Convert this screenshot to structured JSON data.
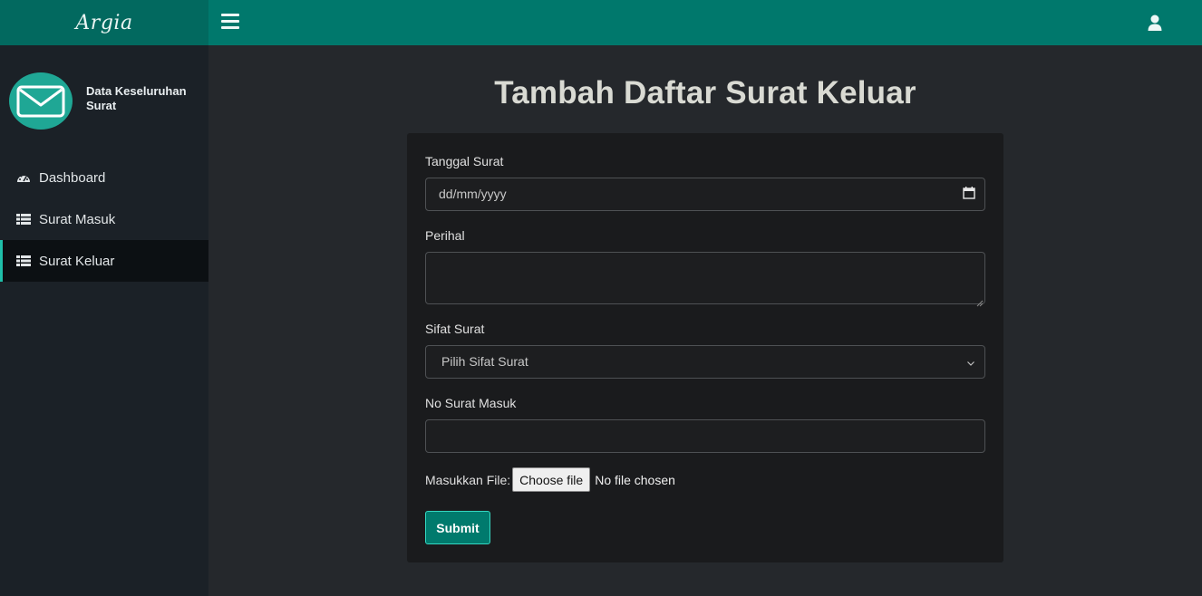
{
  "brand": {
    "name": "Argia"
  },
  "topbar": {
    "menu_icon": "hamburger-icon",
    "user_icon": "user-icon",
    "color": "#00786c"
  },
  "sidebar": {
    "profile": {
      "avatar_icon": "envelope-icon",
      "name": "Data Keseluruhan Surat"
    },
    "items": [
      {
        "label": "Dashboard",
        "icon": "dashboard-icon",
        "active": false
      },
      {
        "label": "Surat Masuk",
        "icon": "table-icon",
        "active": false
      },
      {
        "label": "Surat Keluar",
        "icon": "table-icon",
        "active": true
      }
    ]
  },
  "main": {
    "title": "Tambah Daftar Surat Keluar",
    "form": {
      "tanggal": {
        "label": "Tanggal Surat",
        "placeholder": "dd/mm/yyyy",
        "value": ""
      },
      "perihal": {
        "label": "Perihal",
        "value": ""
      },
      "sifat": {
        "label": "Sifat Surat",
        "selected": "Pilih Sifat Surat"
      },
      "no_surat": {
        "label": "No Surat Masuk",
        "value": ""
      },
      "file": {
        "label": "Masukkan File:",
        "button": "Choose file",
        "status": "No file chosen"
      },
      "submit": "Submit"
    }
  },
  "colors": {
    "accent": "#00786c",
    "sidebar": "#1b2127",
    "background": "#25282c",
    "card": "#1a1b1d",
    "active_marker": "#1fbfa9"
  }
}
